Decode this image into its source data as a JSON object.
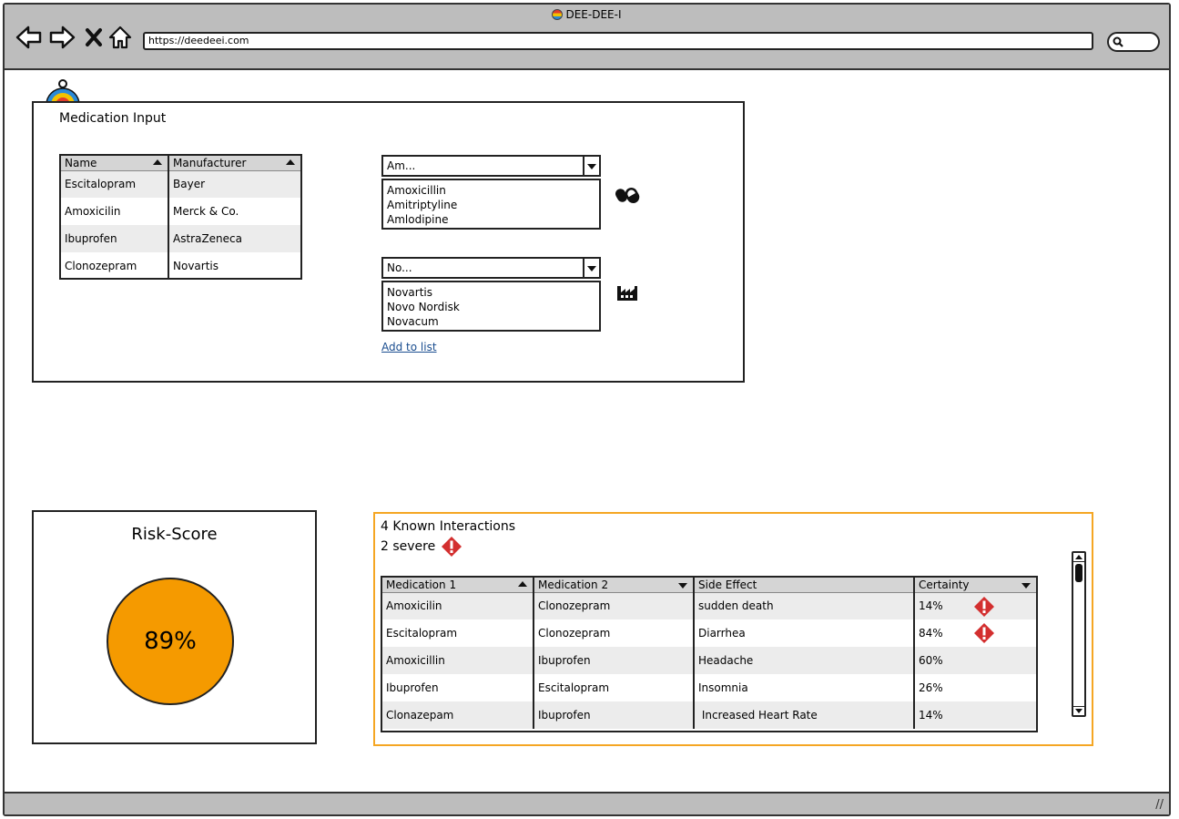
{
  "window": {
    "title": "DEE-DEE-I",
    "url": "https://deedeei.com"
  },
  "medication_input": {
    "title": "Medication Input",
    "table": {
      "headers": [
        "Name",
        "Manufacturer"
      ],
      "rows": [
        [
          "Escitalopram",
          "Bayer"
        ],
        [
          "Amoxicilin",
          "Merck & Co."
        ],
        [
          "Ibuprofen",
          "AstraZeneca"
        ],
        [
          "Clonozepram",
          "Novartis"
        ]
      ]
    },
    "name_combo": {
      "value": "Am...",
      "options": [
        "Amoxicillin",
        "Amitriptyline",
        "Amlodipine"
      ]
    },
    "manufacturer_combo": {
      "value": "No...",
      "options": [
        "Novartis",
        "Novo Nordisk",
        "Novacum"
      ]
    },
    "add_link": "Add to list"
  },
  "risk": {
    "title": "Risk-Score",
    "value": "89%",
    "color": "#f59a00"
  },
  "interactions": {
    "count_label": "4 Known Interactions",
    "severe_label": "2  severe",
    "accent": "#f5a623",
    "headers": [
      "Medication 1",
      "Medication 2",
      "Side Effect",
      "Certainty"
    ],
    "rows": [
      {
        "m1": "Amoxicilin",
        "m2": "Clonozepram",
        "effect": "sudden death",
        "certainty": "14%",
        "severe": true
      },
      {
        "m1": "Escitalopram",
        "m2": "Clonozepram",
        "effect": "Diarrhea",
        "certainty": "84%",
        "severe": true
      },
      {
        "m1": "Amoxicillin",
        "m2": "Ibuprofen",
        "effect": "Headache",
        "certainty": "60%",
        "severe": false
      },
      {
        "m1": "Ibuprofen",
        "m2": "Escitalopram",
        "effect": "Insomnia",
        "certainty": "26%",
        "severe": false
      },
      {
        "m1": "Clonazepam",
        "m2": "Ibuprofen",
        "effect": " Increased Heart Rate",
        "certainty": "14%",
        "severe": false
      }
    ]
  },
  "icons": {
    "pill": "pill-icon",
    "factory": "factory-icon",
    "warning": "warning-icon"
  }
}
